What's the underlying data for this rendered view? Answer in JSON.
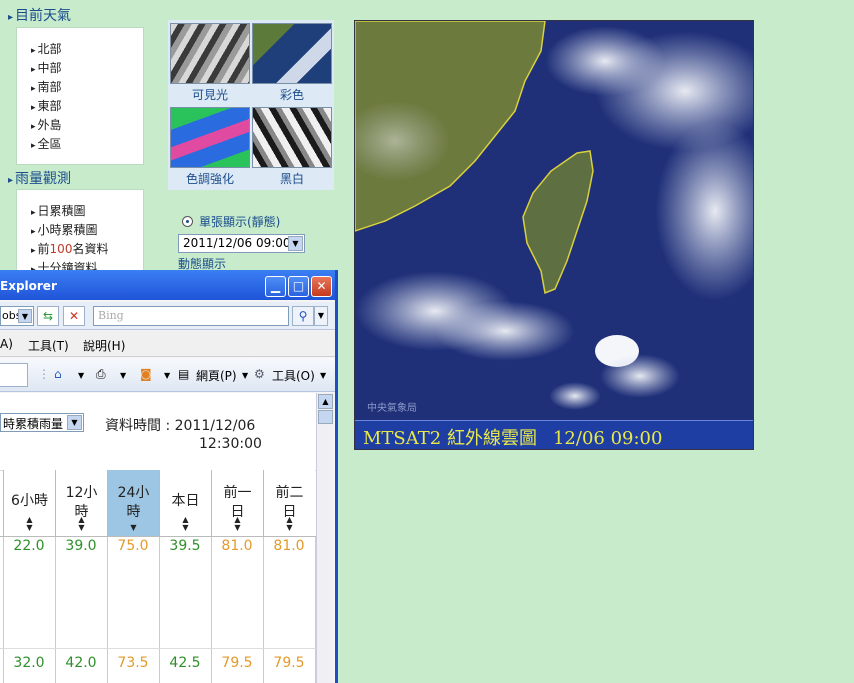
{
  "nav": {
    "section1": "目前天氣",
    "section1_items": [
      "北部",
      "中部",
      "南部",
      "東部",
      "外島",
      "全區"
    ],
    "section2": "雨量觀測",
    "section2_items": [
      "日累積圖",
      "小時累積圖",
      "前",
      "100",
      "名資料",
      "十分鐘資料"
    ]
  },
  "thumbnails": [
    "可見光",
    "彩色",
    "色調強化",
    "黑白"
  ],
  "display": {
    "single_label": "單張顯示(靜態)",
    "time_select": "2011/12/06 09:00",
    "animation_label": "動態顯示"
  },
  "satellite": {
    "caption_name": "MTSAT2 紅外線雲圖",
    "caption_time": "12/06 09:00",
    "credit": "中央氣象局"
  },
  "ie": {
    "title": "Explorer",
    "addr_fragment": "obs",
    "search_placeholder": "Bing",
    "menu": [
      "A)",
      "工具(T)",
      "說明(H)"
    ],
    "cmd_page": "網頁(P)",
    "cmd_tools": "工具(O)"
  },
  "rain_table": {
    "select_value": "時累積雨量",
    "time_label": "資料時間 : 2011/12/06",
    "time_label2": "12:30:00",
    "headers": [
      {
        "line1": "6小時",
        "line2": ""
      },
      {
        "line1": "12小",
        "line2": "時"
      },
      {
        "line1": "24小",
        "line2": "時"
      },
      {
        "line1": "本日",
        "line2": ""
      },
      {
        "line1": "前一",
        "line2": "日"
      },
      {
        "line1": "前二",
        "line2": "日"
      }
    ],
    "selected_column": 2,
    "rows": [
      [
        "22.0",
        "39.0",
        "75.0",
        "39.5",
        "81.0",
        "81.0"
      ],
      [
        "32.0",
        "42.0",
        "73.5",
        "42.5",
        "79.5",
        "79.5"
      ]
    ],
    "colors": [
      "green",
      "green",
      "orange",
      "green",
      "orange",
      "orange"
    ]
  }
}
